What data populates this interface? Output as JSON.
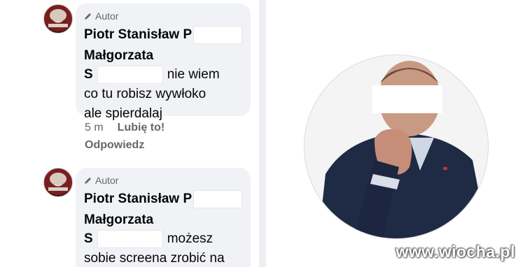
{
  "comments": [
    {
      "author_badge": "Autor",
      "name_line1": "Piotr Stanisław P",
      "name_line2": "Małgorzata",
      "mention_initial": "S",
      "text_after_mention": "nie wiem",
      "text_line2": "co tu robisz wywłoko",
      "text_line3": "ale spierdalaj",
      "time": "5 m",
      "like_label": "Lubię to!",
      "reply_label": "Odpowiedz"
    },
    {
      "author_badge": "Autor",
      "name_line1": "Piotr Stanisław P",
      "name_line2": "Małgorzata",
      "mention_initial": "S",
      "text_after_mention": "możesz",
      "text_line2": "sobie screena zrobić na"
    }
  ],
  "watermark": "www.wiocha.pl",
  "colors": {
    "bubble_bg": "#f0f2f5",
    "meta_text": "#65676b",
    "divider": "#eceef2"
  },
  "icons": {
    "author_badge_icon": "pencil-icon"
  }
}
